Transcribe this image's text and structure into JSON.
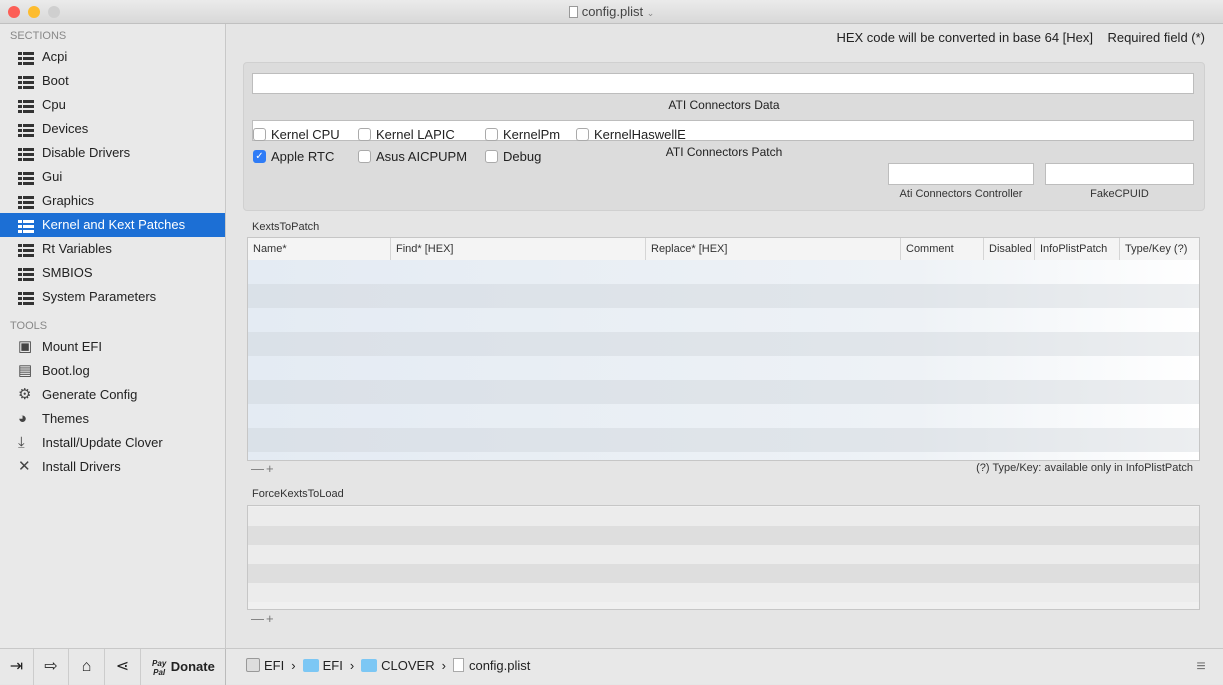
{
  "window": {
    "title": "config.plist"
  },
  "sidebar": {
    "sections_heading": "SECTIONS",
    "sections": [
      "Acpi",
      "Boot",
      "Cpu",
      "Devices",
      "Disable Drivers",
      "Gui",
      "Graphics",
      "Kernel and Kext Patches",
      "Rt Variables",
      "SMBIOS",
      "System Parameters"
    ],
    "selected": "Kernel and Kext Patches",
    "tools_heading": "TOOLS",
    "tools": [
      {
        "label": "Mount EFI",
        "icon": "disk-icon"
      },
      {
        "label": "Boot.log",
        "icon": "log-icon"
      },
      {
        "label": "Generate Config",
        "icon": "gears-icon"
      },
      {
        "label": "Themes",
        "icon": "palette-icon"
      },
      {
        "label": "Install/Update Clover",
        "icon": "download-icon"
      },
      {
        "label": "Install Drivers",
        "icon": "wrench-icon"
      }
    ]
  },
  "header": {
    "hex_note": "HEX code will be converted in base 64 [Hex]",
    "required_note": "Required field (*)"
  },
  "ati": {
    "data_label": "ATI Connectors Data",
    "data_value": "",
    "patch_label": "ATI Connectors Patch",
    "patch_value": "",
    "controller_label": "Ati Connectors Controller",
    "controller_value": "",
    "fakecpuid_label": "FakeCPUID",
    "fakecpuid_value": ""
  },
  "checkboxes": [
    {
      "label": "Kernel CPU",
      "checked": false
    },
    {
      "label": "Kernel LAPIC",
      "checked": false
    },
    {
      "label": "KernelPm",
      "checked": false
    },
    {
      "label": "KernelHaswellE",
      "checked": false
    },
    {
      "label": "Apple RTC",
      "checked": true
    },
    {
      "label": "Asus AICPUPM",
      "checked": false
    },
    {
      "label": "Debug",
      "checked": false
    }
  ],
  "kexts_to_patch": {
    "title": "KextsToPatch",
    "columns": [
      "Name*",
      "Find* [HEX]",
      "Replace* [HEX]",
      "Comment",
      "Disabled",
      "InfoPlistPatch",
      "Type/Key (?)"
    ],
    "rows": [],
    "note": "(?) Type/Key: available only in InfoPlistPatch",
    "remove": "—",
    "add": "+"
  },
  "force_kexts": {
    "title": "ForceKextsToLoad",
    "rows": [],
    "remove": "—",
    "add": "+"
  },
  "bottom": {
    "donate": "Donate",
    "paypal": "Pay Pal",
    "path": [
      "EFI",
      "EFI",
      "CLOVER",
      "config.plist"
    ]
  }
}
